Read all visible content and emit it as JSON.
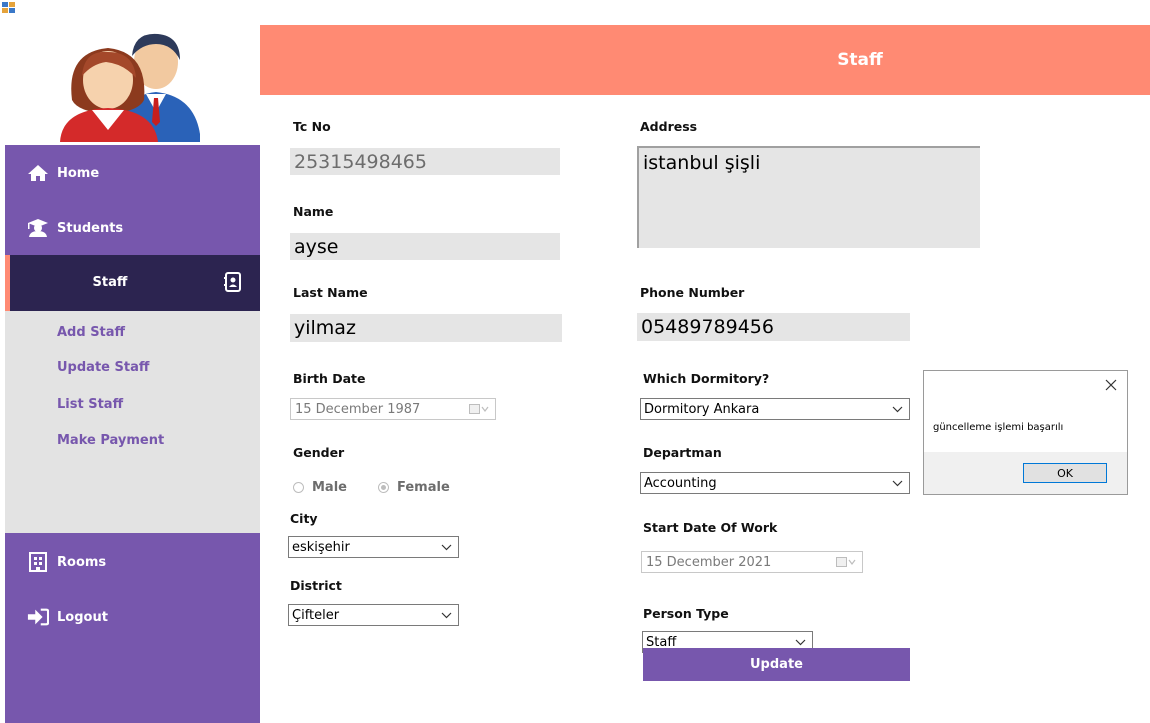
{
  "sidebar": {
    "items": [
      {
        "label": "Home",
        "icon": "home-icon"
      },
      {
        "label": "Students",
        "icon": "graduate-icon"
      },
      {
        "label": "Staff",
        "icon": "contact-book-icon"
      },
      {
        "label": "Rooms",
        "icon": "building-icon"
      },
      {
        "label": "Logout",
        "icon": "logout-icon"
      }
    ],
    "submenu": [
      "Add Staff",
      "Update Staff",
      "List Staff",
      "Make Payment"
    ]
  },
  "header": {
    "title": "Staff"
  },
  "form": {
    "tc_no": {
      "label": "Tc No",
      "value": "25315498465"
    },
    "name": {
      "label": "Name",
      "value": "ayse"
    },
    "last_name": {
      "label": "Last Name",
      "value": "yilmaz"
    },
    "birth_date": {
      "label": "Birth Date",
      "value": "15 December 1987"
    },
    "gender": {
      "label": "Gender",
      "options": [
        "Male",
        "Female"
      ],
      "selected": "Female"
    },
    "city": {
      "label": "City",
      "value": "eskişehir"
    },
    "district": {
      "label": "District",
      "value": "Çifteler"
    },
    "address": {
      "label": "Address",
      "value": "istanbul şişli"
    },
    "phone": {
      "label": "Phone Number",
      "value": "05489789456"
    },
    "dormitory": {
      "label": "Which Dormitory?",
      "value": "Dormitory Ankara"
    },
    "department": {
      "label": "Departman",
      "value": "Accounting"
    },
    "start_date": {
      "label": "Start Date Of Work",
      "value": "15 December 2021"
    },
    "person_type": {
      "label": "Person Type",
      "value": "Staff"
    },
    "update_label": "Update"
  },
  "dialog": {
    "message": "güncelleme işlemi başarılı",
    "ok_label": "OK"
  },
  "colors": {
    "sidebar": "#7757ad",
    "active": "#2c2450",
    "accent": "#ff8a73",
    "header": "#ff8a73"
  }
}
